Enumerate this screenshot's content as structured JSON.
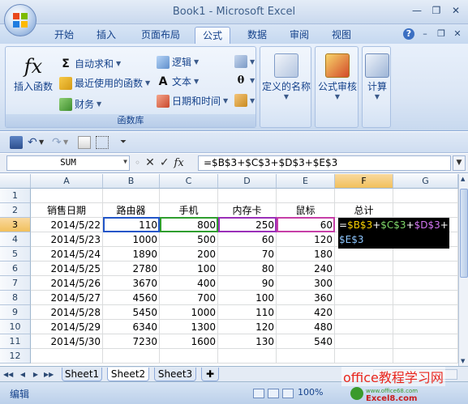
{
  "window": {
    "title": "Book1 - Microsoft Excel"
  },
  "ribbon": {
    "tabs": [
      "开始",
      "插入",
      "页面布局",
      "公式",
      "数据",
      "审阅",
      "视图"
    ],
    "active_tab": "公式",
    "groups": {
      "function_library": {
        "label": "函数库",
        "insert_function": "插入函数",
        "autosum": "自动求和",
        "recently_used": "最近使用的函数",
        "financial": "财务",
        "logical": "逻辑",
        "text": "文本",
        "date_time": "日期和时间"
      },
      "defined_names": "定义的名称",
      "formula_auditing": "公式审核",
      "calculation": "计算"
    }
  },
  "formula_bar": {
    "name_box": "SUM",
    "formula": "=$B$3+$C$3+$D$3+$E$3"
  },
  "grid": {
    "columns": [
      "A",
      "B",
      "C",
      "D",
      "E",
      "F",
      "G"
    ],
    "rows": [
      "1",
      "2",
      "3",
      "4",
      "5",
      "6",
      "7",
      "8",
      "9",
      "10",
      "11",
      "12"
    ],
    "headers": [
      "销售日期",
      "路由器",
      "手机",
      "内存卡",
      "鼠标",
      "总计"
    ],
    "data": [
      [
        "2014/5/22",
        "110",
        "800",
        "250",
        "60"
      ],
      [
        "2014/5/23",
        "1000",
        "500",
        "60",
        "120"
      ],
      [
        "2014/5/24",
        "1890",
        "200",
        "70",
        "180"
      ],
      [
        "2014/5/25",
        "2780",
        "100",
        "80",
        "240"
      ],
      [
        "2014/5/26",
        "3670",
        "400",
        "90",
        "300"
      ],
      [
        "2014/5/27",
        "4560",
        "700",
        "100",
        "360"
      ],
      [
        "2014/5/28",
        "5450",
        "1000",
        "110",
        "420"
      ],
      [
        "2014/5/29",
        "6340",
        "1300",
        "120",
        "480"
      ],
      [
        "2014/5/30",
        "7230",
        "1600",
        "130",
        "540"
      ]
    ],
    "active_cell": "F3",
    "edit_text": {
      "eq": "=",
      "b": "$B$3",
      "plus1": "+",
      "c": "$C$3",
      "plus2": "+",
      "d": "$D$3",
      "plus3": "+",
      "e": "$E$3"
    }
  },
  "sheets": [
    "Sheet1",
    "Sheet2",
    "Sheet3"
  ],
  "active_sheet": "Sheet2",
  "status": {
    "mode": "编辑",
    "zoom": "100%"
  },
  "watermark": {
    "text": "office教程学习网",
    "url": "www.office68.com",
    "logo_text": "Excel8.com"
  },
  "colors": {
    "ref_b": "#f7d000",
    "ref_c": "#7fd86a",
    "ref_d": "#d275f2",
    "ref_e": "#8ec7ff",
    "accent": "#15428b"
  }
}
